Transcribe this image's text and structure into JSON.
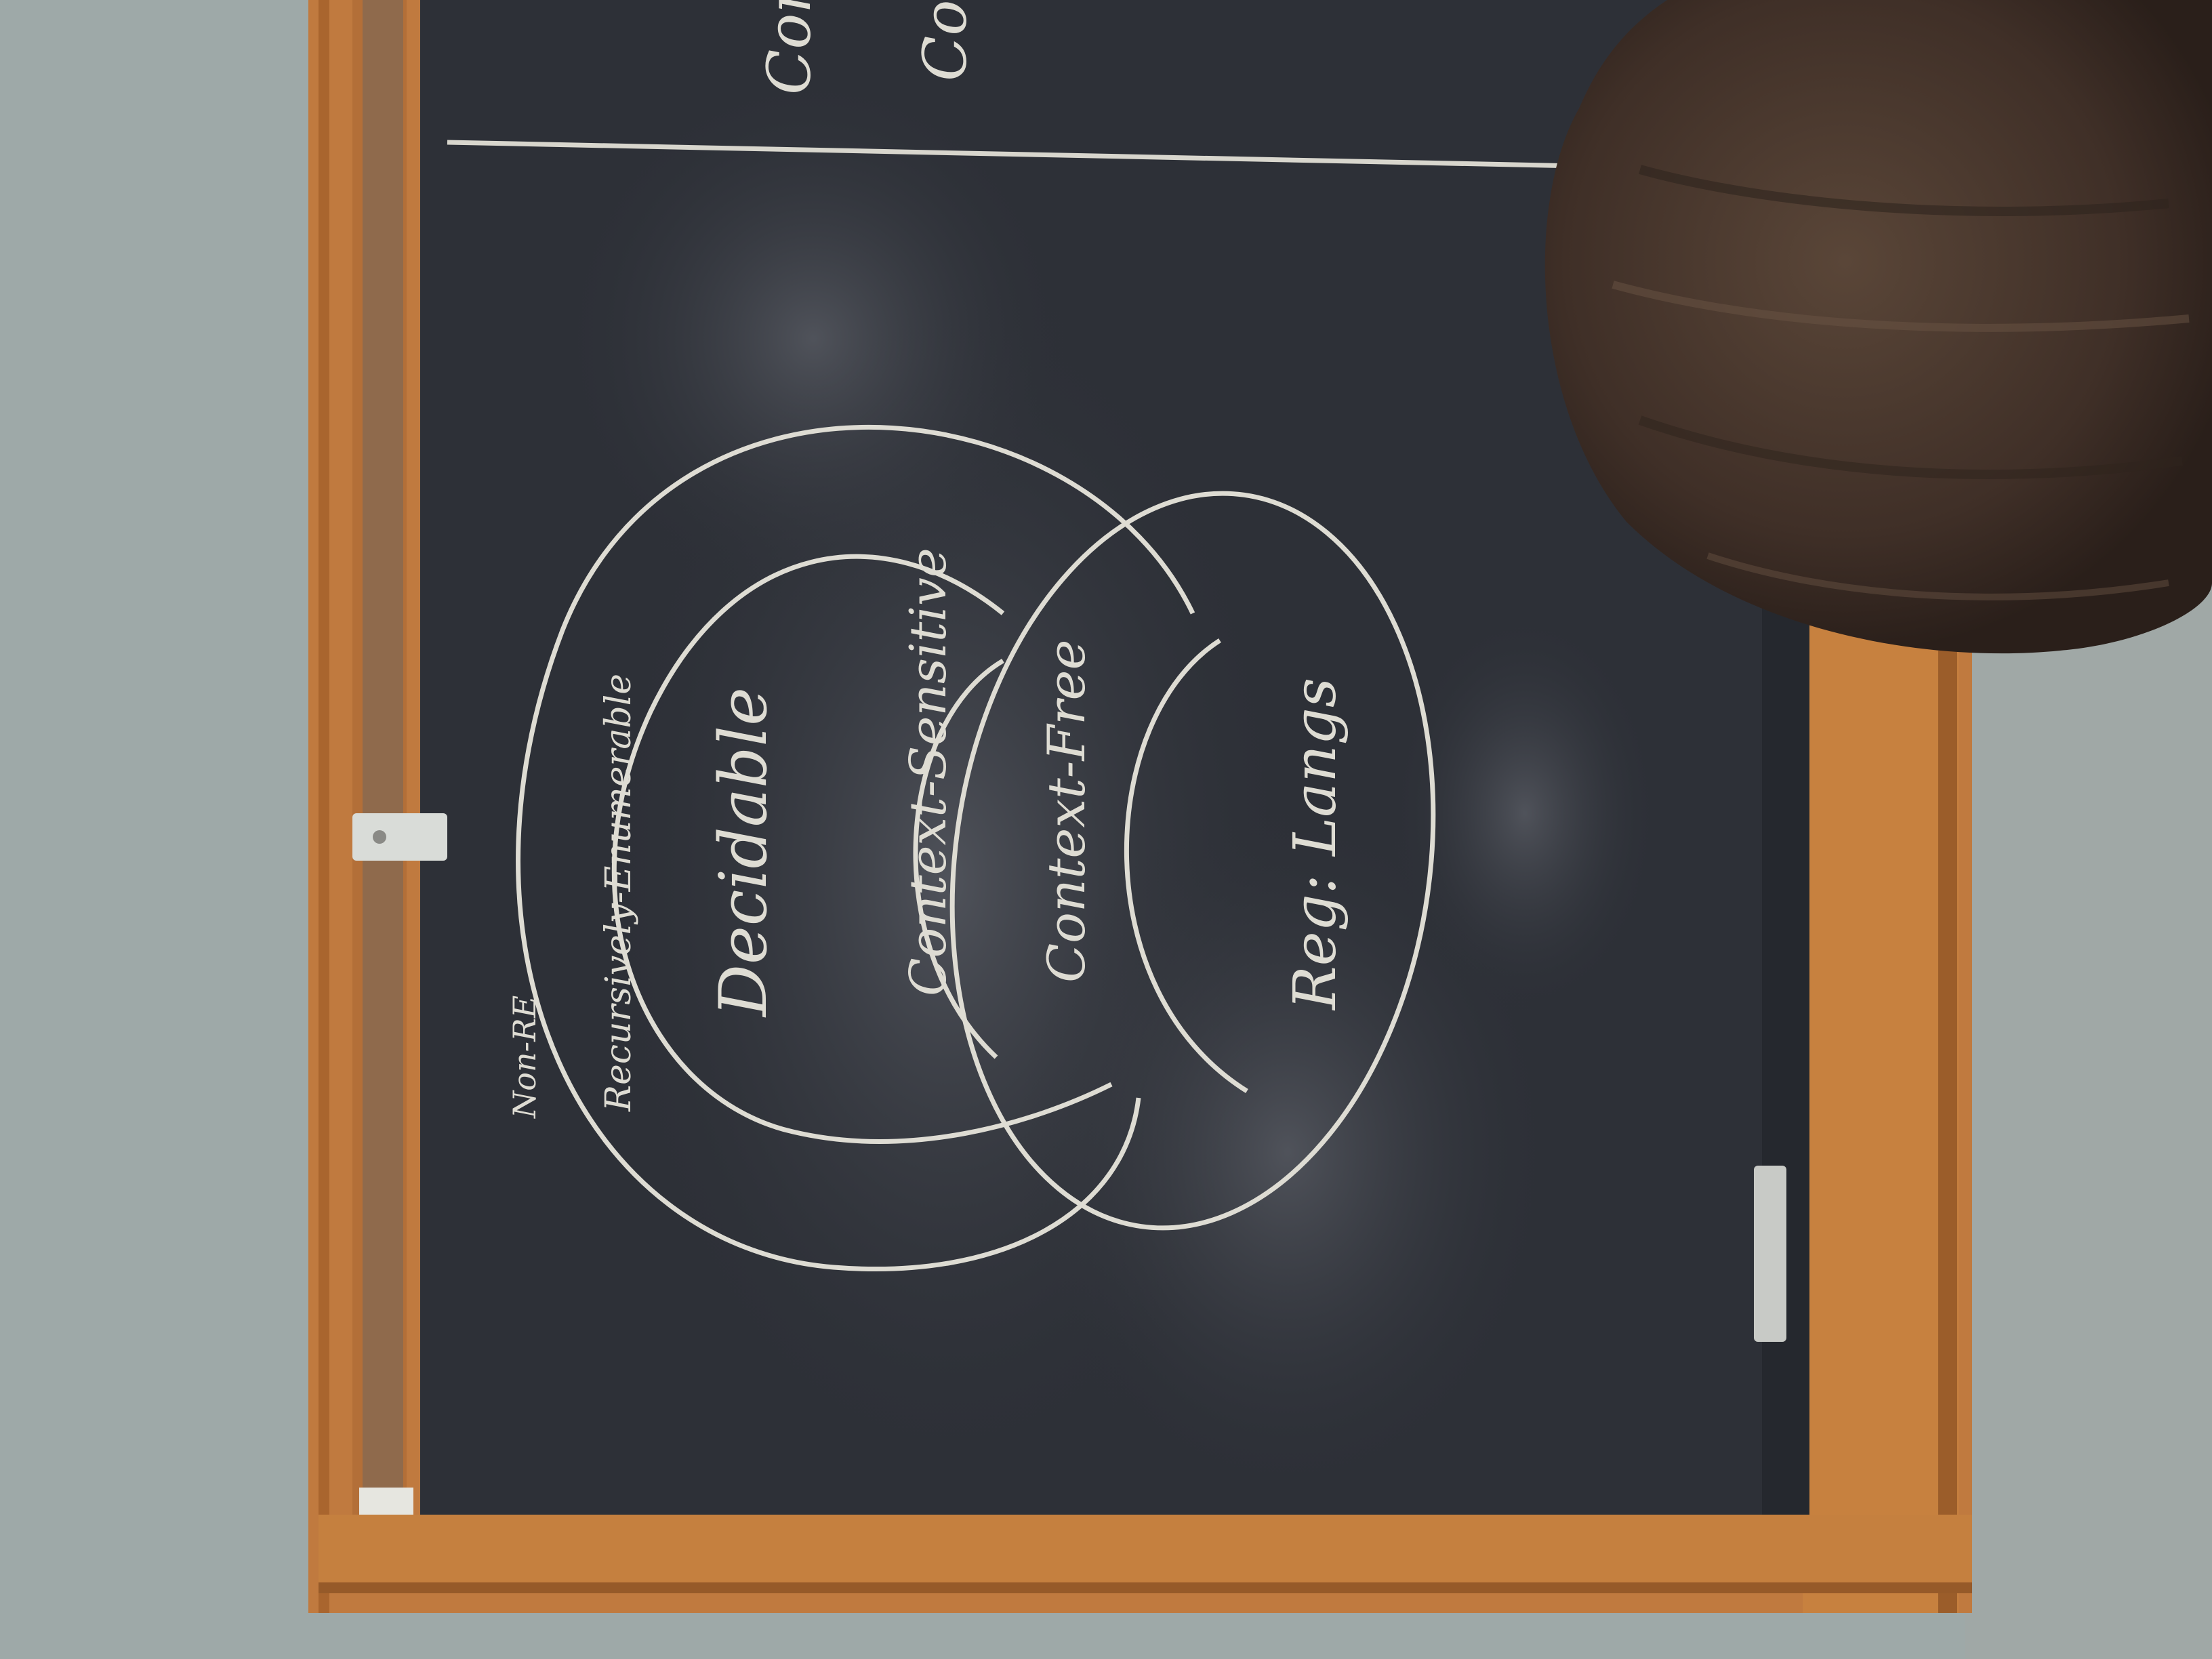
{
  "photo": {
    "subject": "chalkboard",
    "orientation": "rotated"
  },
  "chalkboard": {
    "top_text_1": "Con",
    "top_text_2": "Co",
    "labels": {
      "non_re": "Non-RE",
      "re": "Recursively-Enumerable",
      "decidable": "Decidable",
      "csl": "Context-Sensitive",
      "cfl": "Context-Free",
      "regular": "Reg: Langs"
    }
  },
  "colors": {
    "wall": "#9ea9a8",
    "board": "#2d3037",
    "frame": "#c07a3f",
    "chalk": "#dedcd3",
    "hair": "#4a3a31"
  }
}
